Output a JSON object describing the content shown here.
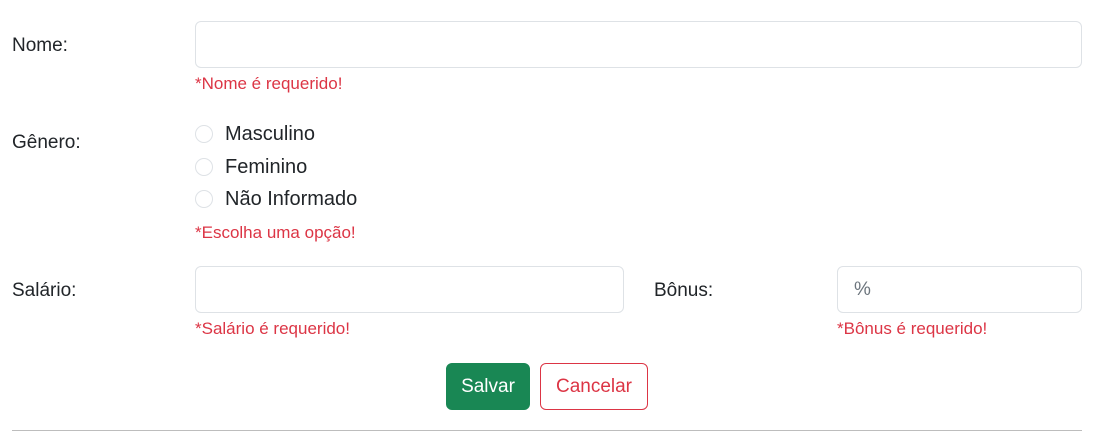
{
  "form": {
    "nome": {
      "label": "Nome:",
      "value": "",
      "error": "*Nome é requerido!"
    },
    "genero": {
      "label": "Gênero:",
      "options": [
        "Masculino",
        "Feminino",
        "Não Informado"
      ],
      "error": "*Escolha uma opção!"
    },
    "salario": {
      "label": "Salário:",
      "value": "",
      "error": "*Salário é requerido!"
    },
    "bonus": {
      "label": "Bônus:",
      "placeholder": "%",
      "value": "",
      "error": "*Bônus é requerido!"
    },
    "buttons": {
      "save_label": "Salvar",
      "cancel_label": "Cancelar"
    }
  },
  "colors": {
    "error": "#dc3545",
    "save": "#198754",
    "border": "#dee2e6"
  }
}
